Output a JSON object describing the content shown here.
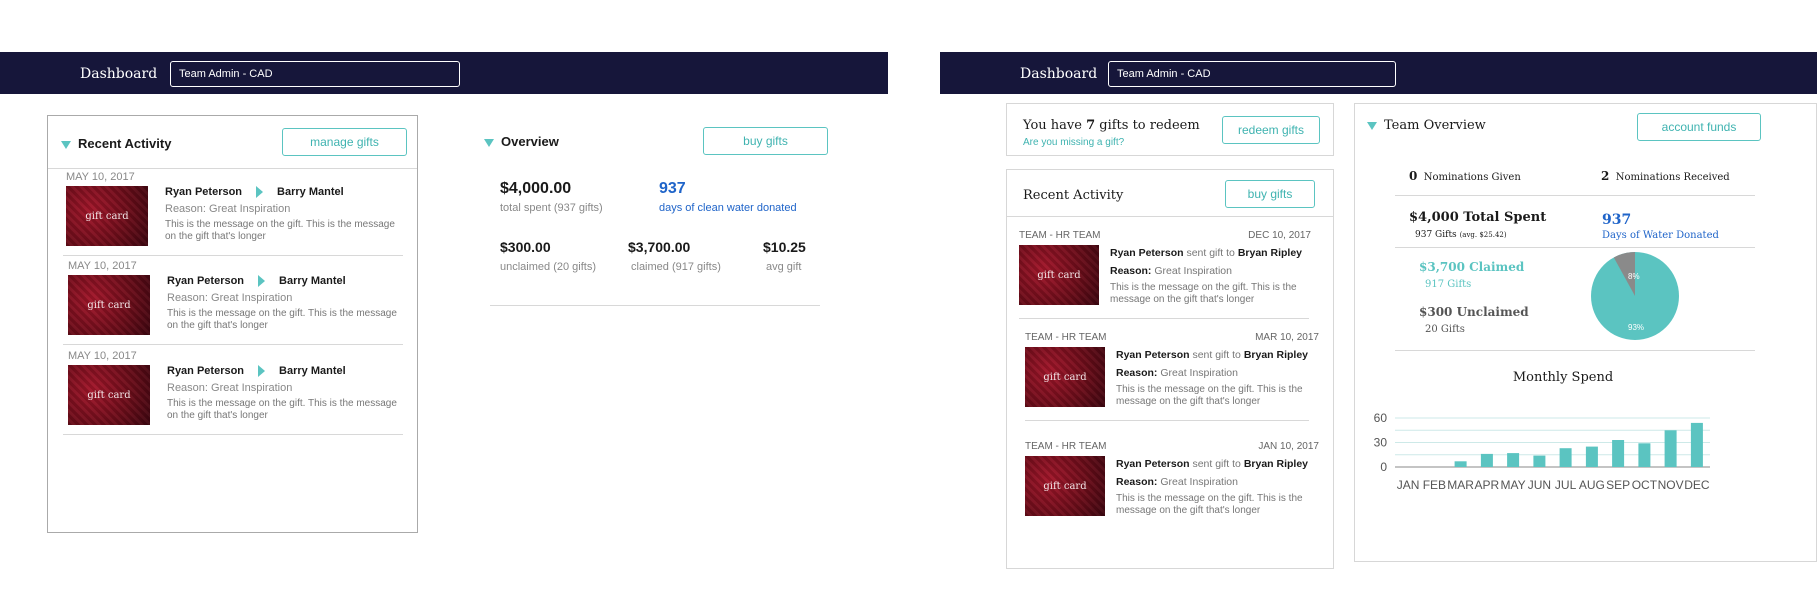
{
  "left": {
    "topbar": {
      "title": "Dashboard",
      "select_value": "Team Admin - CAD"
    },
    "recent_activity": {
      "title": "Recent Activity",
      "button": "manage gifts",
      "items": [
        {
          "date": "MAY 10, 2017",
          "from": "Ryan Peterson",
          "to": "Barry Mantel",
          "reason": "Reason: Great Inspiration",
          "message": "This is the message on the gift. This is the message on the gift that's longer",
          "image_label": "gift card"
        },
        {
          "date": "MAY 10, 2017",
          "from": "Ryan Peterson",
          "to": "Barry Mantel",
          "reason": "Reason: Great Inspiration",
          "message": "This is the message on the gift. This is the message on the gift that's longer",
          "image_label": "gift card"
        },
        {
          "date": "MAY 10, 2017",
          "from": "Ryan Peterson",
          "to": "Barry Mantel",
          "reason": "Reason: Great Inspiration",
          "message": "This is the message on the gift. This is the message on the gift that's longer",
          "image_label": "gift card"
        }
      ]
    },
    "overview": {
      "title": "Overview",
      "button": "buy gifts",
      "total_spent": "$4,000.00",
      "total_spent_label": "total spent (937 gifts)",
      "water_days": "937",
      "water_label": "days of clean water donated",
      "unclaimed": "$300.00",
      "unclaimed_label": "unclaimed (20 gifts)",
      "claimed": "$3,700.00",
      "claimed_label": "claimed (917 gifts)",
      "avg": "$10.25",
      "avg_label": "avg gift"
    }
  },
  "right": {
    "topbar": {
      "title": "Dashboard",
      "select_value": "Team Admin - CAD"
    },
    "redeem": {
      "prefix": "You have ",
      "count": "7",
      "suffix": " gifts to redeem",
      "link": "Are you missing a gift?",
      "button": "redeem gifts"
    },
    "recent_activity": {
      "title": "Recent Activity",
      "button": "buy gifts",
      "sent_word": "sent gift to",
      "reason_label": "Reason:",
      "items": [
        {
          "team": "TEAM - HR TEAM",
          "date": "DEC 10, 2017",
          "from": "Ryan Peterson",
          "to": "Bryan Ripley",
          "reason": "Great Inspiration",
          "message": "This is the message on the gift. This is the message on the gift that's longer",
          "image_label": "gift card"
        },
        {
          "team": "TEAM - HR TEAM",
          "date": "MAR 10, 2017",
          "from": "Ryan Peterson",
          "to": "Bryan Ripley",
          "reason": "Great Inspiration",
          "message": "This is the message on the gift. This is the message on the gift that's longer",
          "image_label": "gift card"
        },
        {
          "team": "TEAM - HR TEAM",
          "date": "JAN 10, 2017",
          "from": "Ryan Peterson",
          "to": "Bryan Ripley",
          "reason": "Great Inspiration",
          "message": "This is the message on the gift. This is the message on the gift that's longer",
          "image_label": "gift card"
        }
      ]
    },
    "team_overview": {
      "title": "Team Overview",
      "button": "account funds",
      "nominations_given_count": "0",
      "nominations_given_label": "Nominations Given",
      "nominations_received_count": "2",
      "nominations_received_label": "Nominations Received",
      "total_spent": "$4,000 Total Spent",
      "gifts_count": "937 Gifts",
      "gifts_avg": "(avg. $25.42)",
      "water_days": "937",
      "water_label": "Days of Water Donated",
      "claimed": "$3,700 Claimed",
      "claimed_gifts": "917 Gifts",
      "unclaimed": "$300 Unclaimed",
      "unclaimed_gifts": "20 Gifts",
      "pie_small_label": "8%",
      "pie_large_label": "93%"
    },
    "colors": {
      "navy": "#16163a",
      "teal": "#5bc4c1",
      "blue": "#1f64c9",
      "gray_slice": "#8a8a8a"
    }
  },
  "chart_data": {
    "type": "bar",
    "title": "Monthly Spend",
    "categories": [
      "JAN",
      "FEB",
      "MAR",
      "APR",
      "MAY",
      "JUN",
      "JUL",
      "AUG",
      "SEP",
      "OCT",
      "NOV",
      "DEC"
    ],
    "values": [
      0,
      0,
      7,
      16,
      17,
      14,
      23,
      25,
      33,
      29,
      45,
      54
    ],
    "yticks": [
      "60",
      "30",
      "0"
    ],
    "ylim": [
      0,
      60
    ],
    "grid": true
  }
}
